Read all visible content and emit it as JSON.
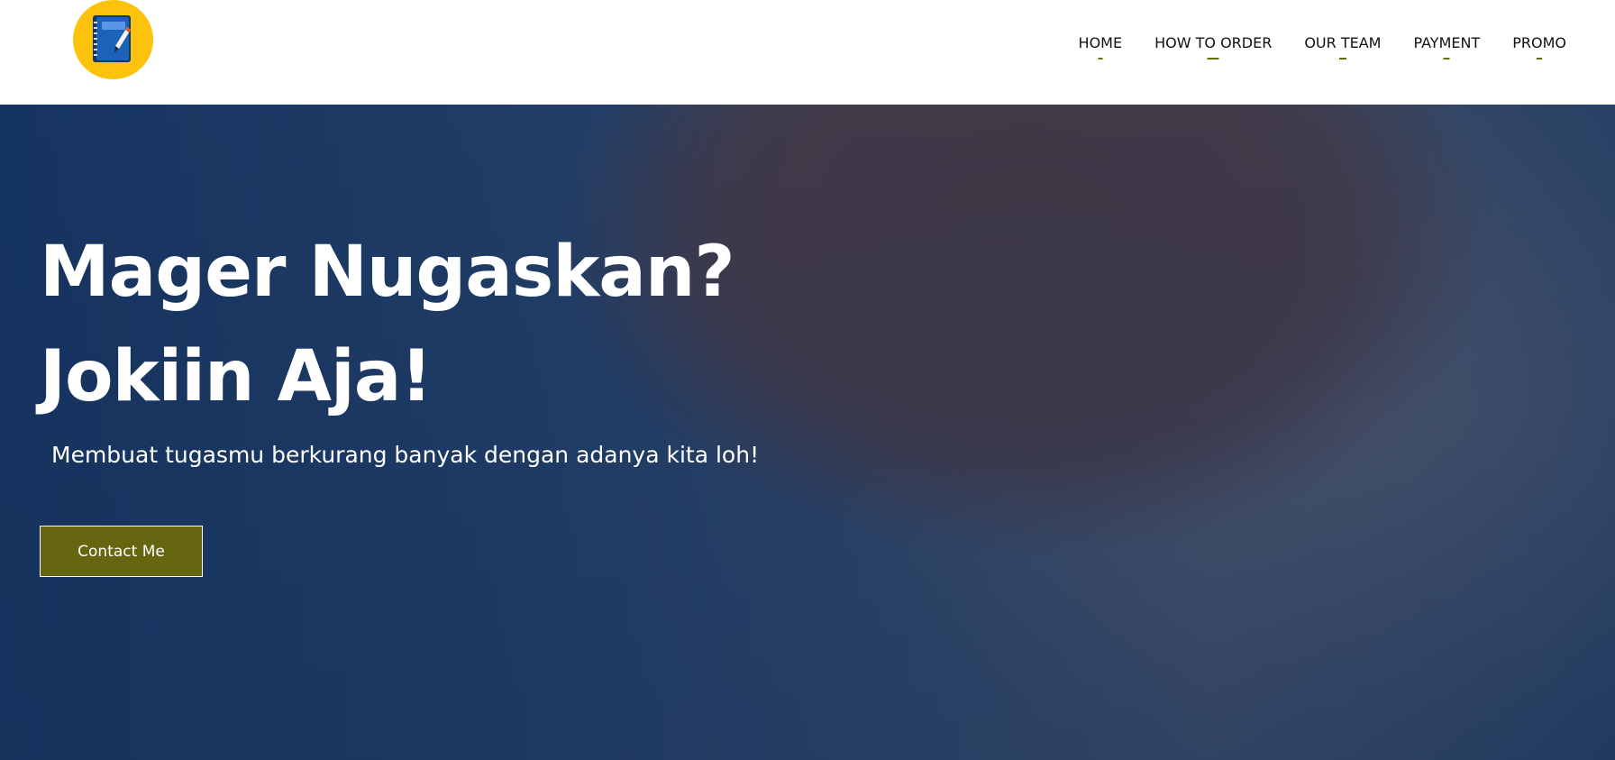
{
  "brand": {
    "logo_icon": "notebook-pen-icon",
    "logo_bg_color": "#fcc20c"
  },
  "nav": {
    "items": [
      {
        "label": "HOME"
      },
      {
        "label": "HOW TO ORDER"
      },
      {
        "label": "OUR TEAM"
      },
      {
        "label": "PAYMENT"
      },
      {
        "label": "PROMO"
      }
    ],
    "underline_color": "#6b6f0a"
  },
  "hero": {
    "title_line1": "Mager Nugaskan?",
    "title_line2": "Jokiin Aja!",
    "subtitle": "Membuat tugasmu berkurang banyak dengan adanya kita loh!",
    "cta_label": "Contact Me",
    "cta_color": "#666510"
  }
}
